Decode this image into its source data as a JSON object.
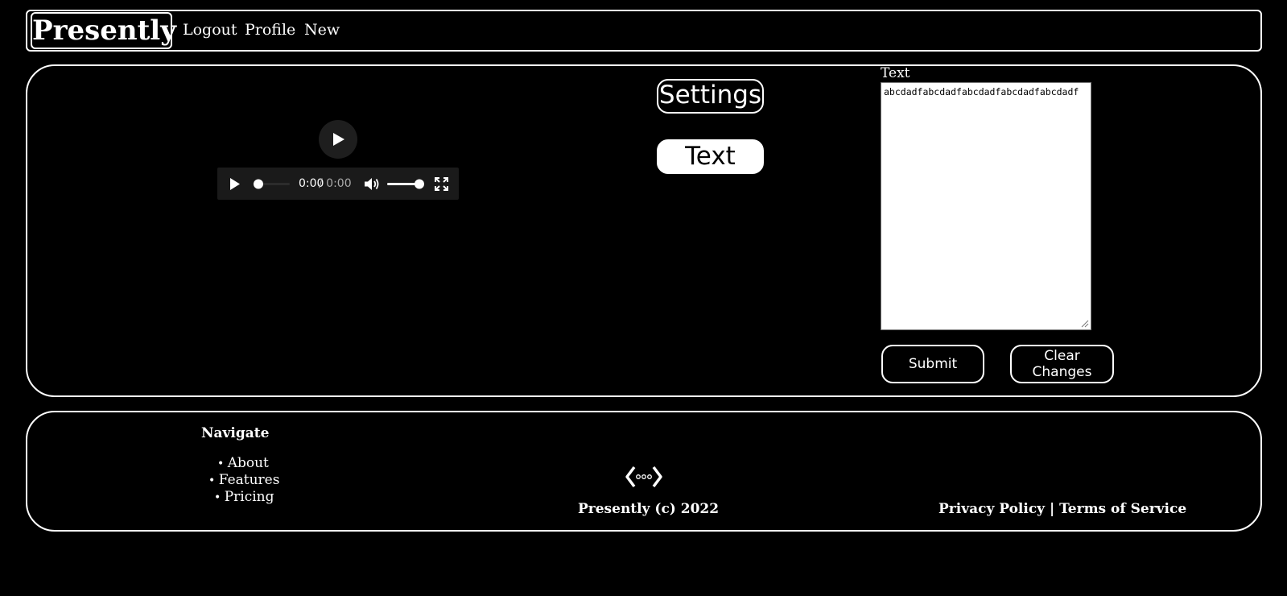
{
  "header": {
    "brand": "Presently",
    "links": [
      "Logout",
      "Profile",
      "New"
    ]
  },
  "player": {
    "time_current": "0:00",
    "time_separator": " / 0:00",
    "volume_level": 1.0,
    "progress": 0.0
  },
  "tabs": {
    "settings_label": "Settings",
    "text_label": "Text",
    "active": "Text"
  },
  "editor": {
    "label": "Text",
    "value": "abcdadfabcdadfabcdadfabcdadfabcdadf",
    "submit_label": "Submit",
    "clear_label_line1": "Clear",
    "clear_label_line2": "Changes"
  },
  "footer": {
    "navigate_heading": "Navigate",
    "links": [
      "About",
      "Features",
      "Pricing"
    ],
    "copyright": "Presently (c) 2022",
    "privacy": "Privacy Policy",
    "separator": " | ",
    "terms": "Terms of Service"
  },
  "colors": {
    "background": "#000000",
    "foreground": "#ffffff",
    "player_bg": "#1a1a1a"
  },
  "icons": [
    "play-icon",
    "volume-icon",
    "fullscreen-icon",
    "code-logo-icon",
    "resize-grip-icon"
  ]
}
